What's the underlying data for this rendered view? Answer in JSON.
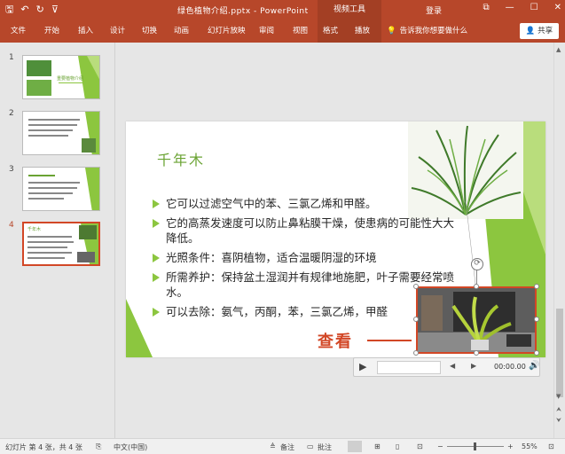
{
  "titlebar": {
    "document_title": "绿色植物介绍.pptx - PowerPoint",
    "context_group": "视频工具",
    "login": "登录",
    "qat": {
      "save": "🖫",
      "undo": "↶",
      "redo": "↻",
      "customize": "⊽"
    },
    "window": {
      "restore": "⧉",
      "minimize": "—",
      "maximize": "☐",
      "close": "✕"
    }
  },
  "ribbon": {
    "tabs": [
      "文件",
      "开始",
      "插入",
      "设计",
      "切换",
      "动画",
      "幻灯片放映",
      "审阅",
      "视图",
      "格式",
      "播放"
    ],
    "tellme": "告诉我你想要做什么",
    "share": "共享"
  },
  "thumbnails": {
    "numbers": [
      "1",
      "2",
      "3",
      "4"
    ],
    "slide1_title": "重要植物介绍",
    "slide4_title": "千年木"
  },
  "slide": {
    "title": "千年木",
    "bullets": [
      "它可以过滤空气中的苯、三氯乙烯和甲醛。",
      "它的高蒸发速度可以防止鼻粘膜干燥，使患病的可能性大大降低。",
      "光照条件：喜阴植物，适合温暖阴湿的环境",
      "所需养护：保持盆土湿润并有规律地施肥，叶子需要经常喷水。",
      "可以去除：氨气，丙酮，苯，三氯乙烯，甲醛"
    ],
    "callout": "查看"
  },
  "media": {
    "time": "00:00.00",
    "play_icon": "▶",
    "prev_icon": "◀",
    "next_icon": "▶",
    "volume_icon": "🔊"
  },
  "scrollbar": {
    "up": "▲",
    "down": "▼",
    "page_up": "⮝",
    "page_down": "⮟"
  },
  "statusbar": {
    "slide_info": "幻灯片 第 4 张，共 4 张",
    "language": "中文(中国)",
    "notes": "备注",
    "comments": "批注",
    "zoom": "55%",
    "zoom_minus": "−",
    "zoom_plus": "+"
  },
  "colors": {
    "accent": "#b7472a",
    "selection": "#d24726",
    "green": "#8cc63f",
    "title_green": "#6aa333"
  }
}
